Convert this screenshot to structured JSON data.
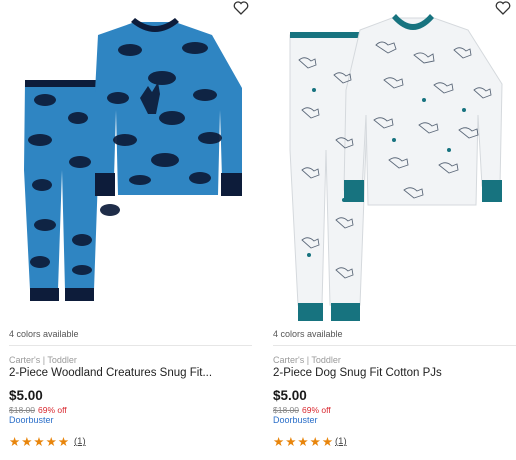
{
  "products": [
    {
      "image_alt": "Blue woodland creatures pajama set",
      "colors_available": "4 colors available",
      "brand": "Carter's | Toddler",
      "title": "2-Piece Woodland Creatures Snug Fit...",
      "price": "$5.00",
      "original_price": "$18.00",
      "discount": "69% off",
      "deal_label": "Doorbuster",
      "stars": "★★★★★",
      "review_count": "(1)"
    },
    {
      "image_alt": "White dog print pajama set",
      "colors_available": "4 colors available",
      "brand": "Carter's | Toddler",
      "title": "2-Piece Dog Snug Fit Cotton PJs",
      "price": "$5.00",
      "original_price": "$18.00",
      "discount": "69% off",
      "deal_label": "Doorbuster",
      "stars": "★★★★★",
      "review_count": "(1)"
    }
  ],
  "colors": {
    "blue_fabric": "#2f85c2",
    "navy_cuff": "#0d1c3a",
    "white_fabric": "#f2f4f6",
    "teal_cuff": "#17737f",
    "star": "#e8850c",
    "discount": "#d9282f",
    "deal": "#2b6fc9"
  }
}
